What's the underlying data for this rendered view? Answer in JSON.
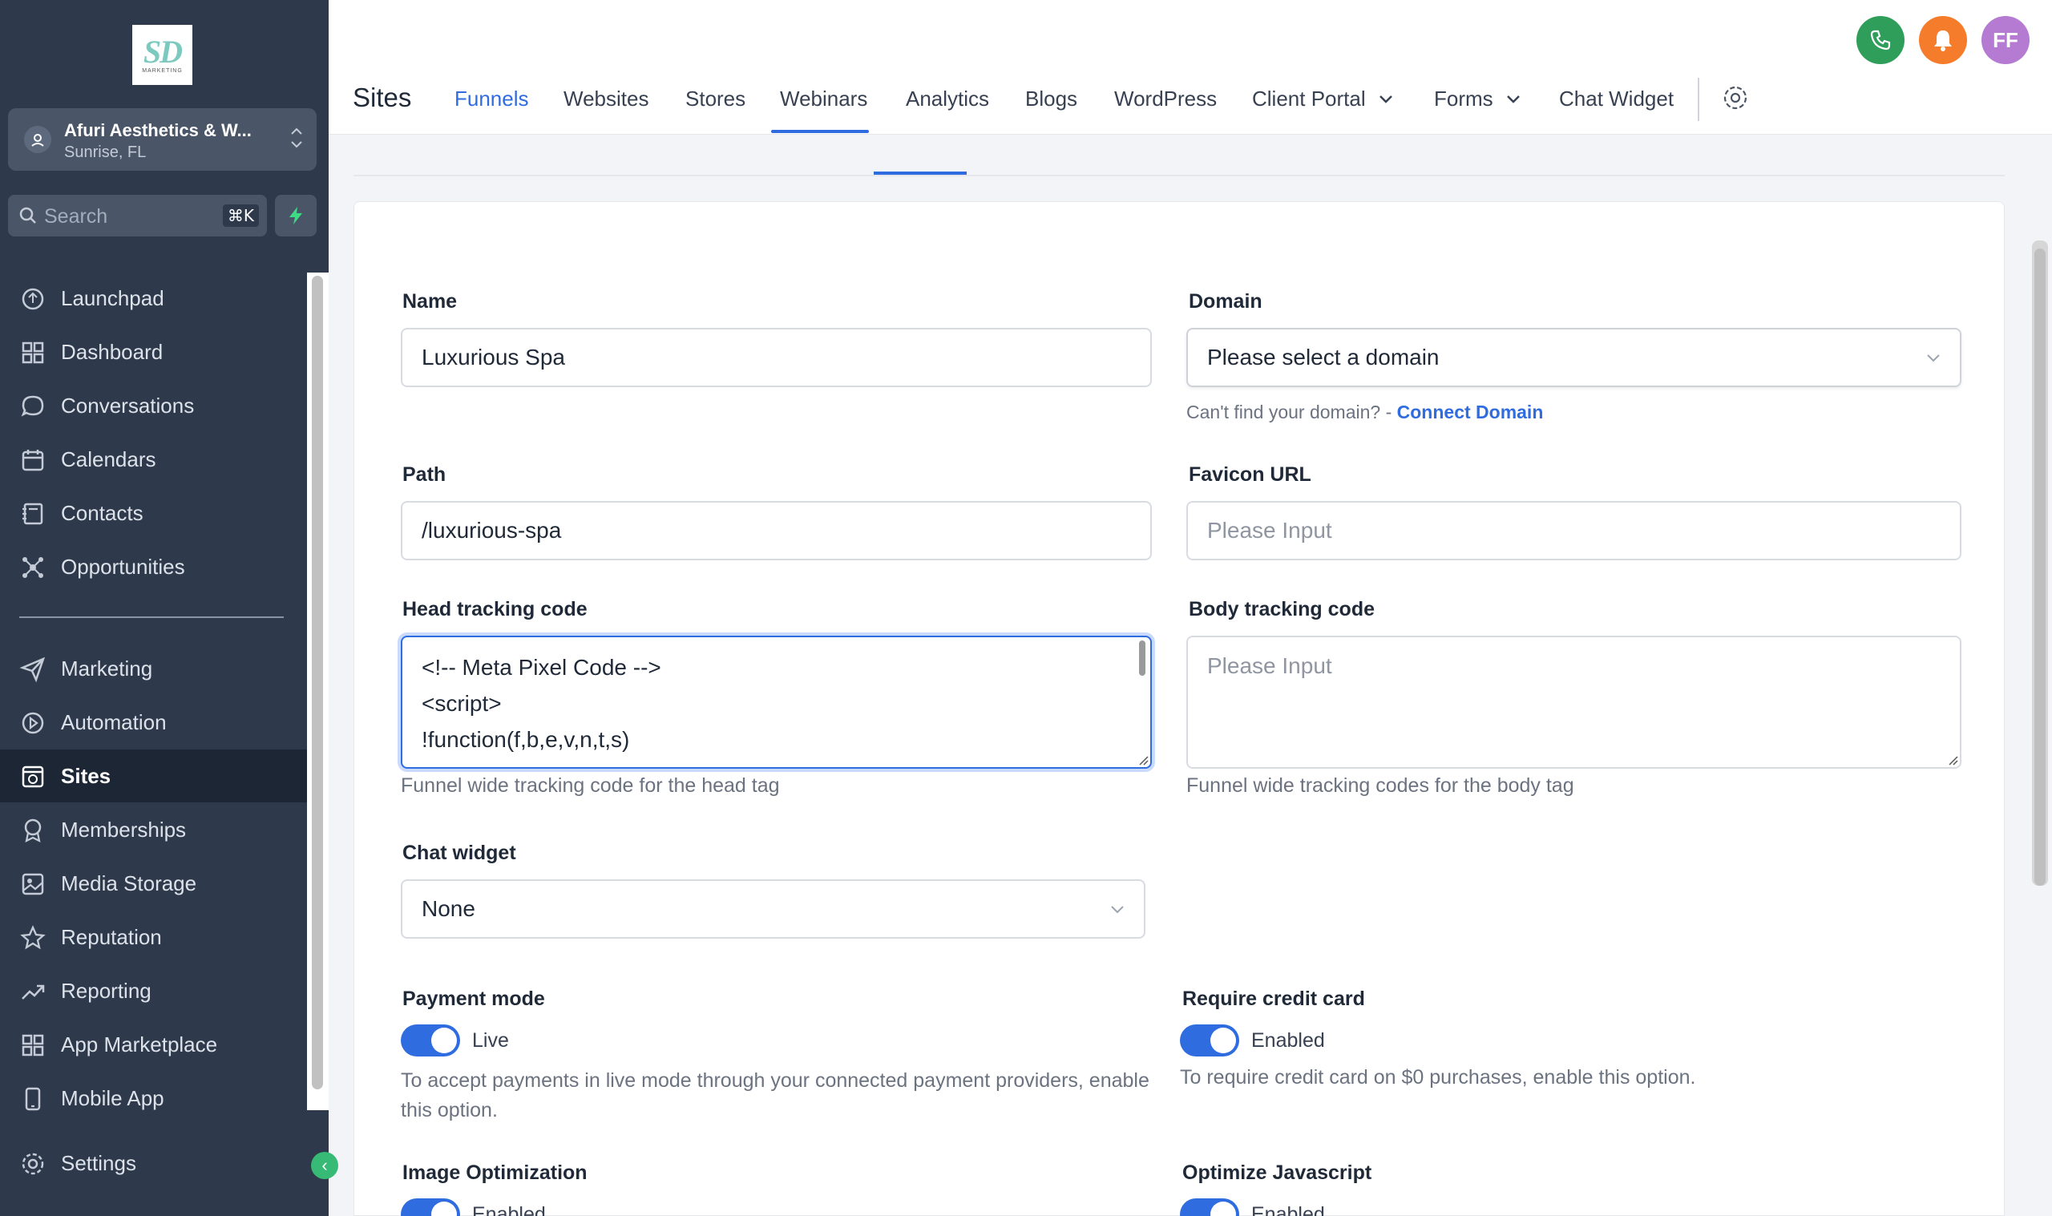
{
  "sidebar": {
    "logo_text": "SD",
    "logo_sub": "MARKETING",
    "account": {
      "name": "Afuri Aesthetics & W...",
      "location": "Sunrise, FL"
    },
    "search": {
      "placeholder": "Search",
      "shortcut": "⌘K"
    },
    "items": [
      {
        "label": "Launchpad",
        "icon": "launchpad-icon"
      },
      {
        "label": "Dashboard",
        "icon": "dashboard-icon"
      },
      {
        "label": "Conversations",
        "icon": "chat-icon"
      },
      {
        "label": "Calendars",
        "icon": "calendar-icon"
      },
      {
        "label": "Contacts",
        "icon": "contacts-icon"
      },
      {
        "label": "Opportunities",
        "icon": "opportunities-icon"
      },
      {
        "label": "Marketing",
        "icon": "send-icon"
      },
      {
        "label": "Automation",
        "icon": "automation-icon"
      },
      {
        "label": "Sites",
        "icon": "sites-icon",
        "active": true
      },
      {
        "label": "Memberships",
        "icon": "award-icon"
      },
      {
        "label": "Media Storage",
        "icon": "image-icon"
      },
      {
        "label": "Reputation",
        "icon": "star-icon"
      },
      {
        "label": "Reporting",
        "icon": "trend-icon"
      },
      {
        "label": "App Marketplace",
        "icon": "grid-icon"
      },
      {
        "label": "Mobile App",
        "icon": "mobile-icon"
      }
    ],
    "settings_label": "Settings"
  },
  "header": {
    "title": "Sites",
    "tabs": [
      "Funnels",
      "Websites",
      "Stores",
      "Webinars",
      "Analytics",
      "Blogs",
      "WordPress",
      "Client Portal",
      "Forms",
      "Chat Widget"
    ],
    "active_tab": "Funnels",
    "avatar_initials": "FF",
    "colors": {
      "phone": "#2f9e5b",
      "bell": "#f57c2a",
      "avatar": "#b57ad1",
      "accent": "#2f6ce0"
    }
  },
  "form": {
    "name": {
      "label": "Name",
      "value": "Luxurious Spa"
    },
    "domain": {
      "label": "Domain",
      "placeholder": "Please select a domain",
      "help": "Can't find your domain? -",
      "link": "Connect Domain"
    },
    "path": {
      "label": "Path",
      "value": "/luxurious-spa"
    },
    "favicon": {
      "label": "Favicon URL",
      "placeholder": "Please Input"
    },
    "head_code": {
      "label": "Head tracking code",
      "lines": [
        "<!-- Meta Pixel Code -->",
        "<script>",
        "!function(f,b,e,v,n,t,s)"
      ],
      "help": "Funnel wide tracking code for the head tag"
    },
    "body_code": {
      "label": "Body tracking code",
      "placeholder": "Please Input",
      "help": "Funnel wide tracking codes for the body tag"
    },
    "chat_widget": {
      "label": "Chat widget",
      "value": "None"
    },
    "payment_mode": {
      "label": "Payment mode",
      "state": "Live",
      "on": true,
      "help": "To accept payments in live mode through your connected payment providers, enable this option."
    },
    "require_cc": {
      "label": "Require credit card",
      "state": "Enabled",
      "on": true,
      "help": "To require credit card on $0 purchases, enable this option."
    },
    "image_opt": {
      "label": "Image Optimization",
      "state": "Enabled"
    },
    "optimize_js": {
      "label": "Optimize Javascript",
      "state": "Enabled"
    }
  }
}
